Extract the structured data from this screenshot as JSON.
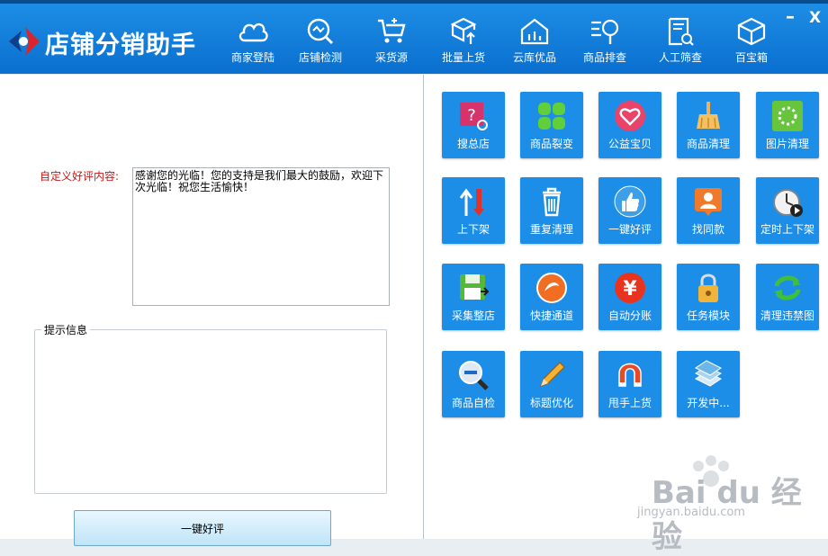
{
  "app": {
    "title": "店铺分销助手"
  },
  "window": {
    "minimize": "–",
    "close": "X"
  },
  "nav": [
    {
      "label": "商家登陆",
      "icon": "cloud-icon"
    },
    {
      "label": "店铺检测",
      "icon": "magnifier-check-icon"
    },
    {
      "label": "采货源",
      "icon": "cart-icon"
    },
    {
      "label": "批量上货",
      "icon": "box-upload-icon"
    },
    {
      "label": "云库优品",
      "icon": "house-icon"
    },
    {
      "label": "商品排查",
      "icon": "list-search-icon"
    },
    {
      "label": "人工筛查",
      "icon": "document-search-icon"
    },
    {
      "label": "百宝箱",
      "icon": "cube-icon"
    }
  ],
  "form": {
    "custom_review_label": "自定义好评内容:",
    "custom_review_value": "感谢您的光临！您的支持是我们最大的鼓励，欢迎下次光临！祝您生活愉快！",
    "hint_label": "提示信息",
    "submit_label": "一键好评"
  },
  "tools": [
    {
      "label": "搜总店",
      "icon": "question-search-icon"
    },
    {
      "label": "商品裂变",
      "icon": "four-leaf-icon"
    },
    {
      "label": "公益宝贝",
      "icon": "heart-icon"
    },
    {
      "label": "商品清理",
      "icon": "broom-icon"
    },
    {
      "label": "图片清理",
      "icon": "loading-ring-icon"
    },
    {
      "label": "上下架",
      "icon": "up-down-arrow-icon"
    },
    {
      "label": "重复清理",
      "icon": "trash-icon"
    },
    {
      "label": "一键好评",
      "icon": "thumbs-up-icon"
    },
    {
      "label": "找同款",
      "icon": "person-icon"
    },
    {
      "label": "定时上下架",
      "icon": "stopwatch-icon"
    },
    {
      "label": "采集整店",
      "icon": "floppy-icon"
    },
    {
      "label": "快捷通道",
      "icon": "compass-icon"
    },
    {
      "label": "自动分账",
      "icon": "yen-icon"
    },
    {
      "label": "任务模块",
      "icon": "padlock-icon"
    },
    {
      "label": "清理违禁图",
      "icon": "refresh-icon"
    },
    {
      "label": "商品自检",
      "icon": "zoom-out-icon"
    },
    {
      "label": "标题优化",
      "icon": "pencil-icon"
    },
    {
      "label": "甩手上货",
      "icon": "magnet-icon"
    },
    {
      "label": "开发中...",
      "icon": "stack-icon"
    }
  ],
  "watermark": {
    "brand": "Bai du 经验",
    "url": "jingyan.baidu.com"
  }
}
